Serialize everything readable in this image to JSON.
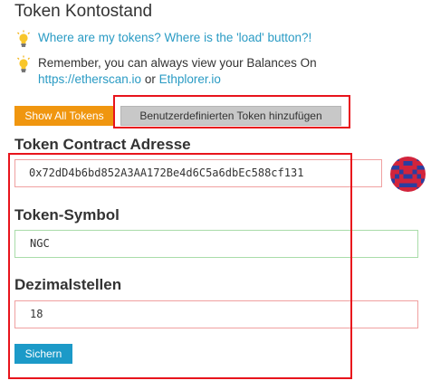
{
  "section": {
    "title": "Token Kontostand"
  },
  "tips": {
    "tip1": {
      "link_text": "Where are my tokens? Where is the 'load' button?!"
    },
    "tip2": {
      "text": "Remember, you can always view your Balances On",
      "link1": "https://etherscan.io",
      "separator": " or ",
      "link2": "Ethplorer.io"
    }
  },
  "buttons": {
    "show_all": "Show All Tokens",
    "add_custom": "Benutzerdefinierten Token hinzufügen",
    "save": "Sichern"
  },
  "form": {
    "address_label": "Token Contract Adresse",
    "address_value": "0x72dD4b6bd852A3AA172Be4d6C5a6dbEc588cf131",
    "symbol_label": "Token-Symbol",
    "symbol_value": "NGC",
    "decimals_label": "Dezimalstellen",
    "decimals_value": "18"
  },
  "icons": {
    "tip_icon": "lightbulb-icon",
    "address_avatar": "identicon"
  },
  "colors": {
    "link": "#2a9bc4",
    "orange_button": "#f0960f",
    "save_button": "#1c9ac8",
    "highlight": "#e8141c",
    "identicon_red": "#d2243c",
    "identicon_blue": "#2b3ea0"
  }
}
